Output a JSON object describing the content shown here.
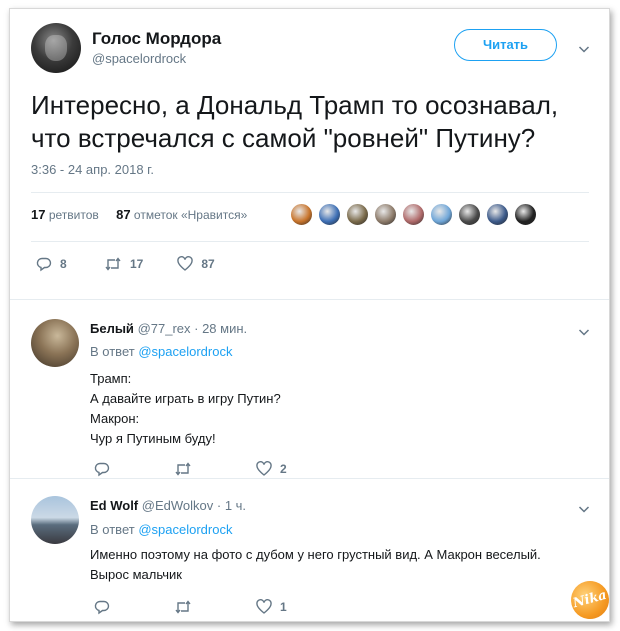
{
  "main_tweet": {
    "author_name": "Голос Мордора",
    "author_handle": "@spacelordrock",
    "follow_label": "Читать",
    "text_line1": "Интересно, а Дональд Трамп то осознавал,",
    "text_line2": "что встречался с самой \"ровней\" Путину?",
    "timestamp": "3:36 - 24 апр. 2018 г.",
    "retweets_count": "17",
    "retweets_label": "ретвитов",
    "likes_count": "87",
    "likes_label": "отметок «Нравится»",
    "actions": {
      "replies": "8",
      "retweets": "17",
      "likes": "87"
    },
    "liker_colors": [
      "#c8742b",
      "#3d6fb5",
      "#7a6a4a",
      "#8d7b6a",
      "#b06a6a",
      "#6fa6d8",
      "#4a4a4a",
      "#3c5a8a",
      "#222222"
    ]
  },
  "replies": [
    {
      "name": "Белый",
      "handle": "@77_rex",
      "time": "· 28 мин.",
      "reply_to_label": "В ответ",
      "reply_to_handle": "@spacelordrock",
      "lines": [
        "Трамп:",
        "А давайте играть в игру Путин?",
        "Макрон:",
        "Чур я Путиным буду!"
      ],
      "actions": {
        "replies": "",
        "retweets": "",
        "likes": "2"
      }
    },
    {
      "name": "Ed Wolf",
      "handle": "@EdWolkov",
      "time": "· 1 ч.",
      "reply_to_label": "В ответ",
      "reply_to_handle": "@spacelordrock",
      "lines": [
        "Именно поэтому на фото с дубом у него грустный вид. А Макрон веселый.",
        "Вырос мальчик"
      ],
      "actions": {
        "replies": "",
        "retweets": "",
        "likes": "1"
      }
    }
  ],
  "watermark": "Nika",
  "colors": {
    "accent": "#1da1f2",
    "secondary_text": "#657786",
    "divider": "#e6ecf0"
  }
}
